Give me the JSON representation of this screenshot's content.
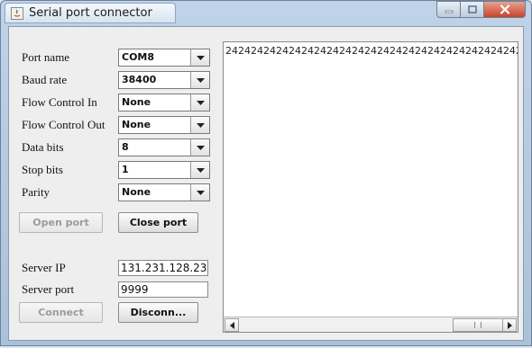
{
  "window": {
    "title": "Serial port connector"
  },
  "settings": {
    "port_name": {
      "label": "Port name",
      "value": "COM8"
    },
    "baud_rate": {
      "label": "Baud rate",
      "value": "38400"
    },
    "flow_in": {
      "label": "Flow Control In",
      "value": "None"
    },
    "flow_out": {
      "label": "Flow Control Out",
      "value": "None"
    },
    "data_bits": {
      "label": "Data bits",
      "value": "8"
    },
    "stop_bits": {
      "label": "Stop bits",
      "value": "1"
    },
    "parity": {
      "label": "Parity",
      "value": "None"
    }
  },
  "port_buttons": {
    "open_label": "Open port",
    "close_label": "Close port"
  },
  "server": {
    "ip_label": "Server IP",
    "ip_value": "131.231.128.23",
    "port_label": "Server port",
    "port_value": "9999"
  },
  "server_buttons": {
    "connect_label": "Connect",
    "disconnect_label": "Disconn..."
  },
  "output": {
    "text": "2424242424242424242424242424242424242424242424242424242424"
  },
  "colors": {
    "title_bar": "#bfd3e8",
    "close_button": "#c7432a",
    "panel": "#eeeeee"
  }
}
